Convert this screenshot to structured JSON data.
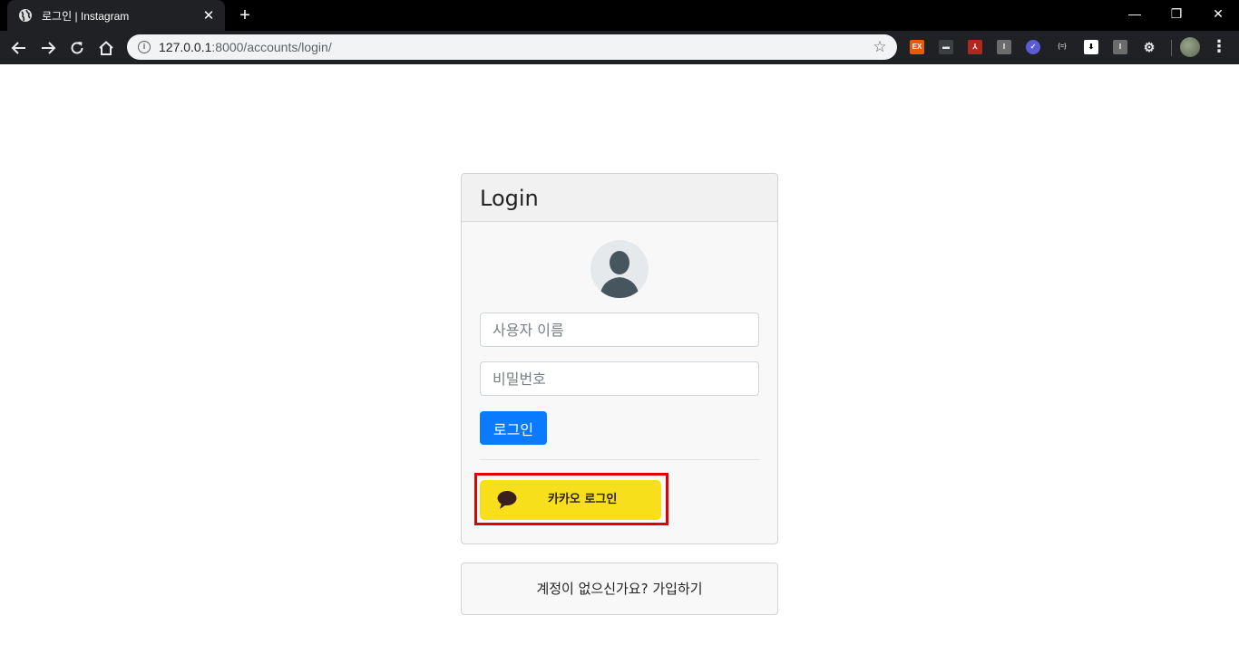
{
  "browser": {
    "tab_title": "로그인 | Instagram",
    "tab_close": "✕",
    "new_tab": "+",
    "url_host": "127.0.0.1",
    "url_rest": ":8000/accounts/login/",
    "window": {
      "minimize": "—",
      "restore": "❐",
      "close": "✕"
    },
    "extensions": [
      {
        "name": "ex-extension-icon",
        "label": "EX",
        "color": "#e8590c"
      },
      {
        "name": "card-extension-icon",
        "label": "▬",
        "color": "#3c4043"
      },
      {
        "name": "pdf-extension-icon",
        "label": "⅄",
        "color": "#b3261e"
      },
      {
        "name": "i-extension-icon",
        "label": "I",
        "color": "#6b6b6b"
      },
      {
        "name": "check-extension-icon",
        "label": "✓",
        "color": "#5b5bd6"
      },
      {
        "name": "braces-extension-icon",
        "label": "{=}",
        "color": "#202124"
      },
      {
        "name": "download-extension-icon",
        "label": "⬇",
        "color": "#ffffff"
      },
      {
        "name": "i2-extension-icon",
        "label": "I",
        "color": "#6b6b6b"
      },
      {
        "name": "gear-extension-icon",
        "label": "⚙",
        "color": "#202124"
      }
    ]
  },
  "login": {
    "title": "Login",
    "username_placeholder": "사용자 이름",
    "password_placeholder": "비밀번호",
    "submit_label": "로그인",
    "kakao_label": "카카오 로그인"
  },
  "signup": {
    "prompt": "계정이 없으신가요?",
    "link": "가입하기"
  },
  "colors": {
    "primary": "#0a7bff",
    "kakao": "#f7e01b",
    "highlight": "#e00000"
  }
}
